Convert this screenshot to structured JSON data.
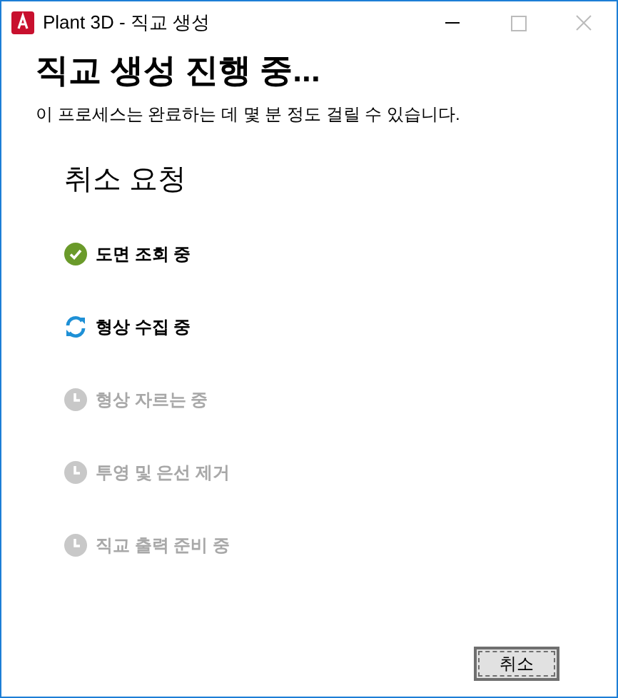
{
  "window": {
    "title": "Plant 3D - 직교 생성"
  },
  "heading": "직교 생성 진행 중...",
  "description": "이 프로세스는 완료하는 데 몇 분 정도 걸릴 수 있습니다.",
  "cancel_request": "취소 요청",
  "steps": [
    {
      "label": "도면 조회 중",
      "kind": "done"
    },
    {
      "label": "형상 수집 중",
      "kind": "running"
    },
    {
      "label": "형상 자르는 중",
      "kind": "pending"
    },
    {
      "label": "투영 및 은선 제거",
      "kind": "pending"
    },
    {
      "label": "직교 출력 준비 중",
      "kind": "pending"
    }
  ],
  "buttons": [
    {
      "label": "취소",
      "focused": true
    }
  ]
}
